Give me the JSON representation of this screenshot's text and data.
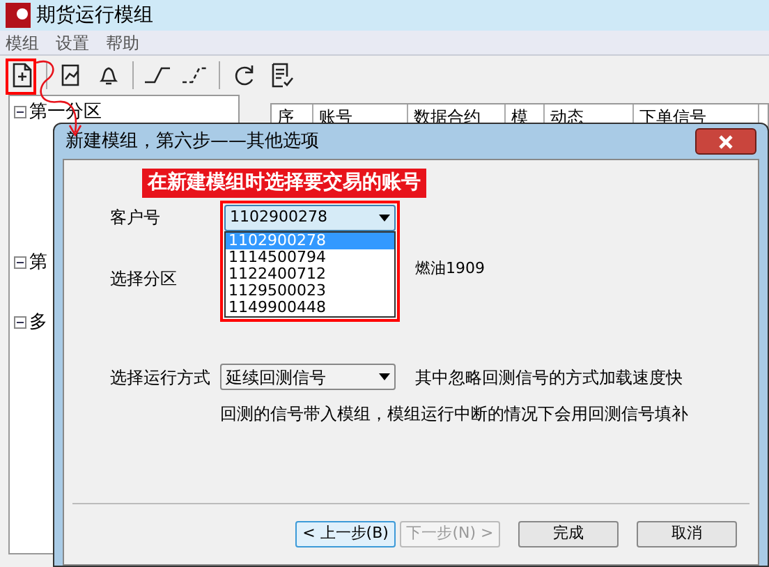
{
  "window": {
    "title": "期货运行模组"
  },
  "menu": [
    "模组",
    "设置",
    "帮助"
  ],
  "tree": [
    {
      "label": "第一分区",
      "expanded": true
    },
    {
      "label": "第",
      "expanded": true
    },
    {
      "label": "多",
      "expanded": true
    }
  ],
  "table": {
    "columns": [
      "序",
      "账号",
      "数据合约",
      "模",
      "动态",
      "下单信号"
    ]
  },
  "dialog": {
    "title": "新建模组，第六步——其他选项",
    "annotation": "在新建模组时选择要交易的账号",
    "account": {
      "label": "客户号",
      "value": "1102900278",
      "options": [
        {
          "label": "1102900278",
          "selected": true
        },
        {
          "label": "1114500794",
          "selected": false
        },
        {
          "label": "1122400712",
          "selected": false
        },
        {
          "label": "1129500023",
          "selected": false
        },
        {
          "label": "1149900448",
          "selected": false
        }
      ]
    },
    "partition": {
      "label": "选择分区",
      "value": "燃油1909"
    },
    "run_mode": {
      "label": "选择运行方式",
      "value": "延续回测信号",
      "hint": "其中忽略回测信号的方式加载速度快",
      "note": "回测的信号带入模组，模组运行中断的情况下会用回测信号填补"
    },
    "buttons": [
      {
        "label": "< 上一步(B)",
        "disabled": false,
        "focused": true
      },
      {
        "label": "下一步(N) >",
        "disabled": true,
        "focused": false
      },
      {
        "label": "完成",
        "disabled": false,
        "focused": false
      },
      {
        "label": "取消",
        "disabled": false,
        "focused": false
      }
    ]
  }
}
